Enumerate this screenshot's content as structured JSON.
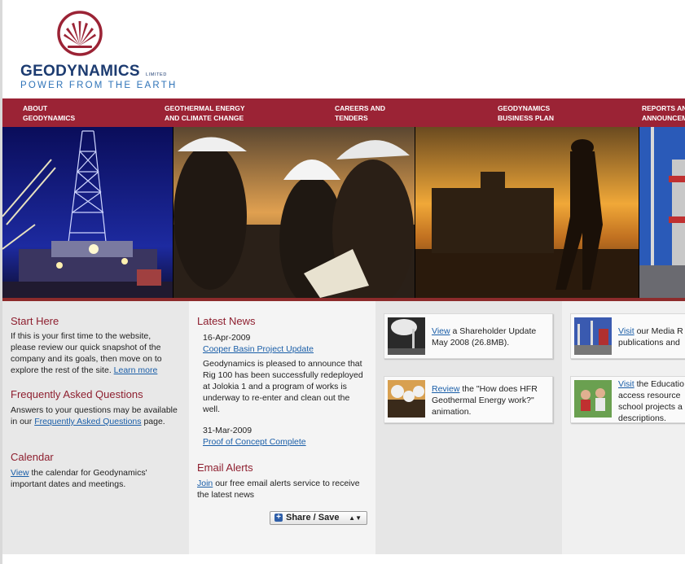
{
  "brand": {
    "name": "GEODYNAMICS",
    "limited": "LIMITED",
    "tagline": "POWER FROM THE EARTH",
    "logo_color": "#9b2335"
  },
  "nav": {
    "items": [
      {
        "line1": "ABOUT",
        "line2": "GEODYNAMICS"
      },
      {
        "line1": "GEOTHERMAL ENERGY",
        "line2": "AND CLIMATE CHANGE"
      },
      {
        "line1": "CAREERS AND",
        "line2": "TENDERS"
      },
      {
        "line1": "GEODYNAMICS",
        "line2": "BUSINESS PLAN"
      },
      {
        "line1": "REPORTS AN",
        "line2": "ANNOUNCEM"
      }
    ]
  },
  "start": {
    "title": "Start Here",
    "text": "If this is your first time to the website, please review our quick snapshot of the company and its goals, then move on to explore the rest of the site.",
    "link": "Learn more"
  },
  "faq": {
    "title": "Frequently Asked Questions",
    "text_before": "Answers to your questions may be available in our",
    "link": "Frequently Asked Questions",
    "text_after": "page."
  },
  "calendar": {
    "title": "Calendar",
    "link": "View",
    "text": "the calendar for Geodynamics' important dates and meetings."
  },
  "news": {
    "title": "Latest News",
    "items": [
      {
        "date": "16-Apr-2009",
        "link": "Cooper Basin Project Update",
        "summary": "Geodynamics is pleased to announce that Rig 100 has been successfully redeployed at Jolokia 1 and a program of works is underway to re-enter and clean out the well."
      },
      {
        "date": "31-Mar-2009",
        "link": "Proof of Concept Complete"
      }
    ]
  },
  "alerts": {
    "title": "Email Alerts",
    "link": "Join",
    "text": "our free email alerts service to receive the latest news"
  },
  "share": {
    "label": "Share / Save"
  },
  "cards": [
    {
      "link": "View",
      "text": "a Shareholder Update May 2008 (26.8MB)."
    },
    {
      "link": "Review",
      "text": "the \"How does HFR Geothermal Energy work?\" animation."
    },
    {
      "link": "Visit",
      "text": "our Media R publications and"
    },
    {
      "link": "Visit",
      "text": "the Educatio access resource school projects a descriptions."
    }
  ]
}
